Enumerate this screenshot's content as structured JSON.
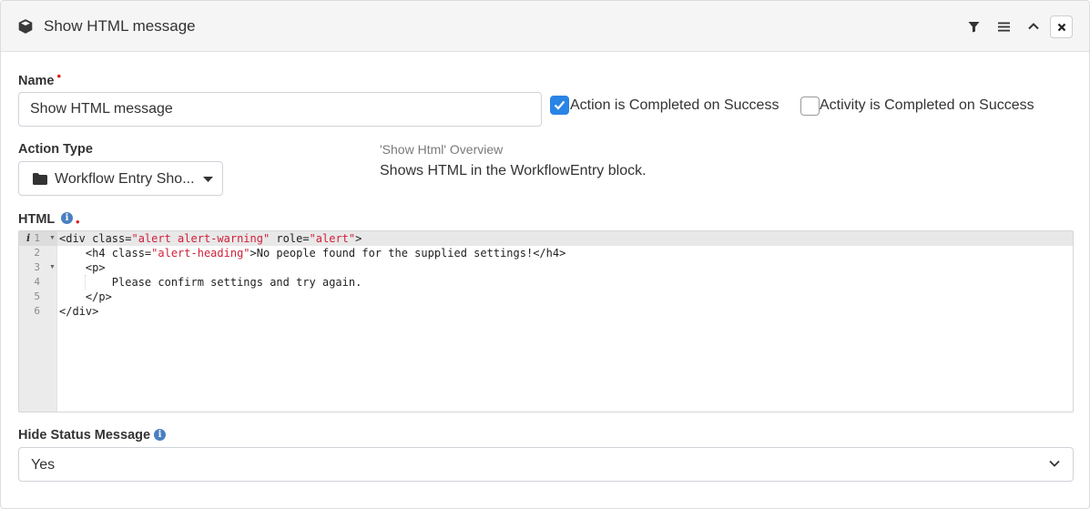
{
  "header": {
    "title": "Show HTML message",
    "cube_icon": "cube-icon",
    "filter_icon": "filter-icon",
    "menu_icon": "menu-icon",
    "collapse_icon": "chevron-up-icon",
    "close_icon": "close-icon"
  },
  "name_field": {
    "label": "Name",
    "required": "•",
    "value": "Show HTML message"
  },
  "checkboxes": [
    {
      "label": "Action is Completed on Success",
      "checked": true
    },
    {
      "label": "Activity is Completed on Success",
      "checked": false
    }
  ],
  "action_type": {
    "label": "Action Type",
    "value": "Workflow Entry Sho...",
    "folder_icon": "folder-icon",
    "caret_icon": "caret-down-icon"
  },
  "overview": {
    "title": "'Show Html' Overview",
    "text": "Shows HTML in the WorkflowEntry block."
  },
  "html_field": {
    "label": "HTML",
    "required": "•",
    "info_icon": "info-icon",
    "gutter_marker": "i",
    "line_numbers": [
      "1",
      "2",
      "3",
      "4",
      "5",
      "6"
    ],
    "code_lines": [
      "<div class=\"alert alert-warning\" role=\"alert\">",
      "    <h4 class=\"alert-heading\">No people found for the supplied settings!</h4>",
      "    <p>",
      "        Please confirm settings and try again.",
      "    </p>",
      "</div>"
    ]
  },
  "hide_status": {
    "label": "Hide Status Message",
    "info_icon": "info-icon",
    "value": "Yes",
    "chevron_icon": "chevron-down-icon"
  },
  "colors": {
    "accent": "#2a84e6",
    "required": "#e02020",
    "string_token": "#d0203a",
    "info_badge": "#4a7fc1"
  }
}
